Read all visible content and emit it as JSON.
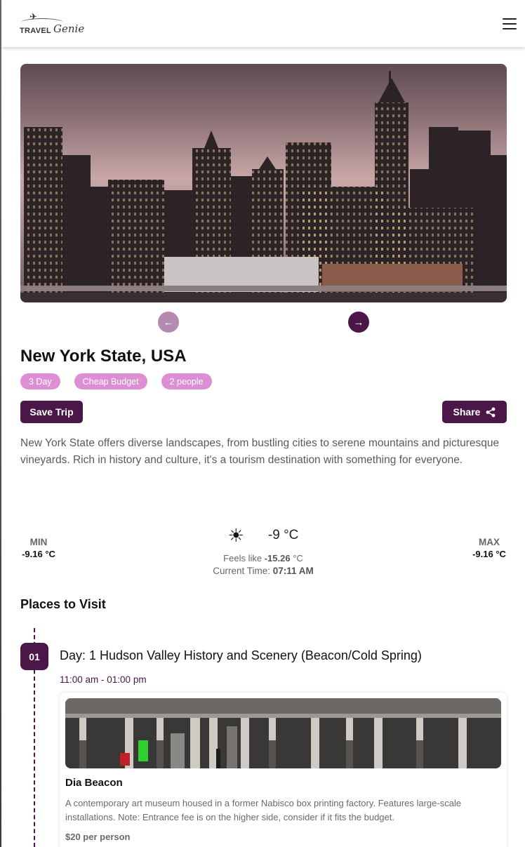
{
  "header": {
    "logo_text": "TRAVEL",
    "logo_script": "Genie"
  },
  "carousel": {
    "prev_icon": "arrow-left-icon",
    "next_icon": "arrow-right-icon"
  },
  "trip": {
    "title": "New York State, USA",
    "chips": [
      "3 Day",
      "Cheap Budget",
      "2 people"
    ],
    "save_label": "Save Trip",
    "share_label": "Share",
    "description": "New York State offers diverse landscapes, from bustling cities to serene mountains and picturesque vineyards. Rich in history and culture, it's a tourism destination with something for everyone."
  },
  "weather": {
    "min_label": "MIN",
    "min_value": "-9.16 °C",
    "max_label": "MAX",
    "max_value": "-9.16 °C",
    "icon": "sun-icon",
    "temp": "-9 °C",
    "feels_label": "Feels like",
    "feels_value": "-15.26",
    "feels_unit": "°C",
    "time_label": "Current Time:",
    "time_value": "07:11 AM"
  },
  "places": {
    "heading": "Places to Visit",
    "days": [
      {
        "number": "01",
        "title": "Day: 1 Hudson Valley History and Scenery (Beacon/Cold Spring)",
        "time": "11:00 am - 01:00 pm",
        "place": {
          "name": "Dia Beacon",
          "description": "A contemporary art museum housed in a former Nabisco box printing factory. Features large-scale installations. Note: Entrance fee is on the higher side, consider if it fits the budget.",
          "price": "$20 per person"
        }
      }
    ]
  },
  "colors": {
    "brand": "#4a1748",
    "chip": "#dd8fd3",
    "prev_button": "#b38ab0"
  }
}
